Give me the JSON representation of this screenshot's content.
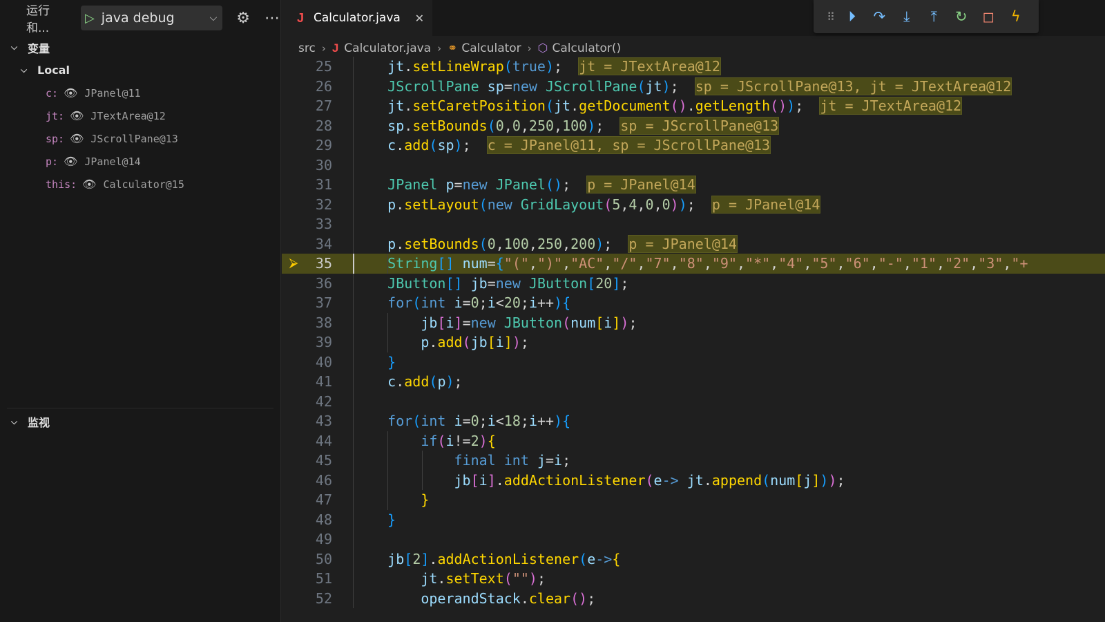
{
  "sidebar": {
    "run_label": "运行和...",
    "config_name": "java debug",
    "variables_title": "变量",
    "local_title": "Local",
    "variables": [
      {
        "name": "c:",
        "value": "JPanel@11"
      },
      {
        "name": "jt:",
        "value": "JTextArea@12"
      },
      {
        "name": "sp:",
        "value": "JScrollPane@13"
      },
      {
        "name": "p:",
        "value": "JPanel@14"
      },
      {
        "name": "this:",
        "value": "Calculator@15"
      }
    ],
    "watch_title": "监视"
  },
  "tab": {
    "name": "Calculator.java"
  },
  "breadcrumb": {
    "src": "src",
    "file": "Calculator.java",
    "class": "Calculator",
    "method": "Calculator()"
  },
  "inline_values": {
    "l25": "jt = JTextArea@12",
    "l26": "sp = JScrollPane@13, jt = JTextArea@12",
    "l27": "jt = JTextArea@12",
    "l28": "sp = JScrollPane@13",
    "l29": "c = JPanel@11, sp = JScrollPane@13",
    "l31": "p = JPanel@14",
    "l32": "p = JPanel@14",
    "l34": "p = JPanel@14"
  },
  "current_line": 35,
  "line_numbers": [
    25,
    26,
    27,
    28,
    29,
    30,
    31,
    32,
    33,
    34,
    35,
    36,
    37,
    38,
    39,
    40,
    41,
    42,
    43,
    44,
    45,
    46,
    47,
    48,
    49,
    50,
    51,
    52
  ]
}
